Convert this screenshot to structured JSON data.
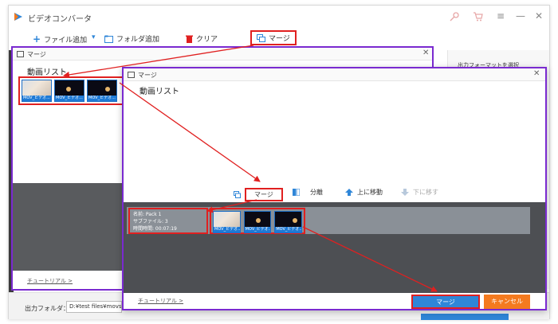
{
  "app": {
    "title": "ビデオコンバータ"
  },
  "toolbar": {
    "add_file": "ファイル追加",
    "add_folder": "フォルダ追加",
    "clear": "クリア",
    "merge": "マージ"
  },
  "right_panel": {
    "output_format_label": "出力フォーマットを選択"
  },
  "bottom": {
    "output_folder_label": "出力フォルダ：",
    "output_folder_value": "D:¥test files¥movs"
  },
  "dialog1": {
    "title": "マージ",
    "list_title": "動画リスト",
    "thumbs": [
      {
        "label": "MOV_ビデオ..."
      },
      {
        "label": "MOV_ビデオ..."
      },
      {
        "label": "MOV_ビデオ..."
      }
    ],
    "tutorial": "チュートリアル >"
  },
  "dialog2": {
    "title": "マージ",
    "list_title": "動画リスト",
    "actions": {
      "merge": "マージ",
      "split": "分離",
      "move_up": "上に移動",
      "move_down": "下に移す"
    },
    "pack": {
      "name": "名前: Pack 1",
      "subfiles": "サブファイル: 3",
      "duration": "時間時間: 00:07:19",
      "thumbs": [
        {
          "label": "MOV_ビデオ..."
        },
        {
          "label": "MOV_ビデオ..."
        },
        {
          "label": "MOV_ビデオ..."
        }
      ]
    },
    "tutorial": "チュートリアル >",
    "merge_button": "マージ",
    "cancel_button": "キャンセル"
  },
  "colors": {
    "accent": "#2f86d8",
    "highlight": "#e02020",
    "dialog_border": "#7a2ad0",
    "cancel": "#f47a1f"
  }
}
